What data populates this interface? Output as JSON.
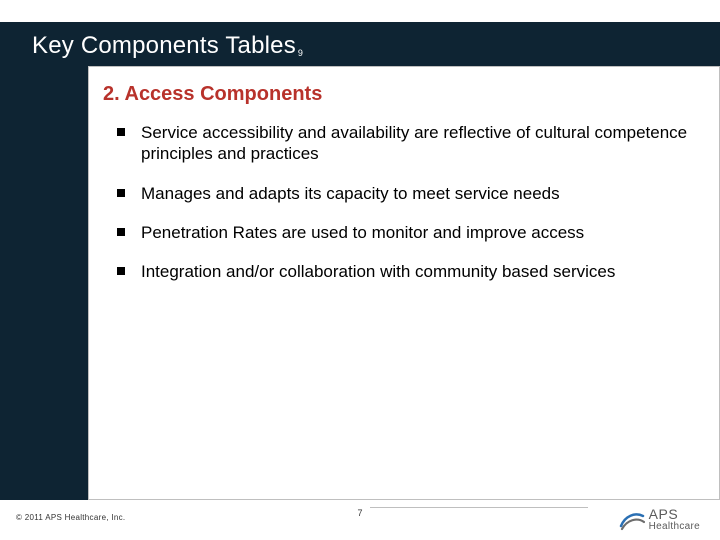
{
  "title": "Key Components Tables",
  "title_sub": "9",
  "section": {
    "heading": "2. Access Components"
  },
  "bullets": [
    "Service accessibility and availability are reflective of cultural competence principles and practices",
    "Manages and adapts its capacity to meet service needs",
    "Penetration Rates are used to monitor and improve access",
    "Integration and/or collaboration with community based services"
  ],
  "footer": {
    "copyright": "© 2011 APS Healthcare, Inc.",
    "page": "7",
    "logo": {
      "aps": "APS",
      "healthcare": "Healthcare"
    }
  }
}
